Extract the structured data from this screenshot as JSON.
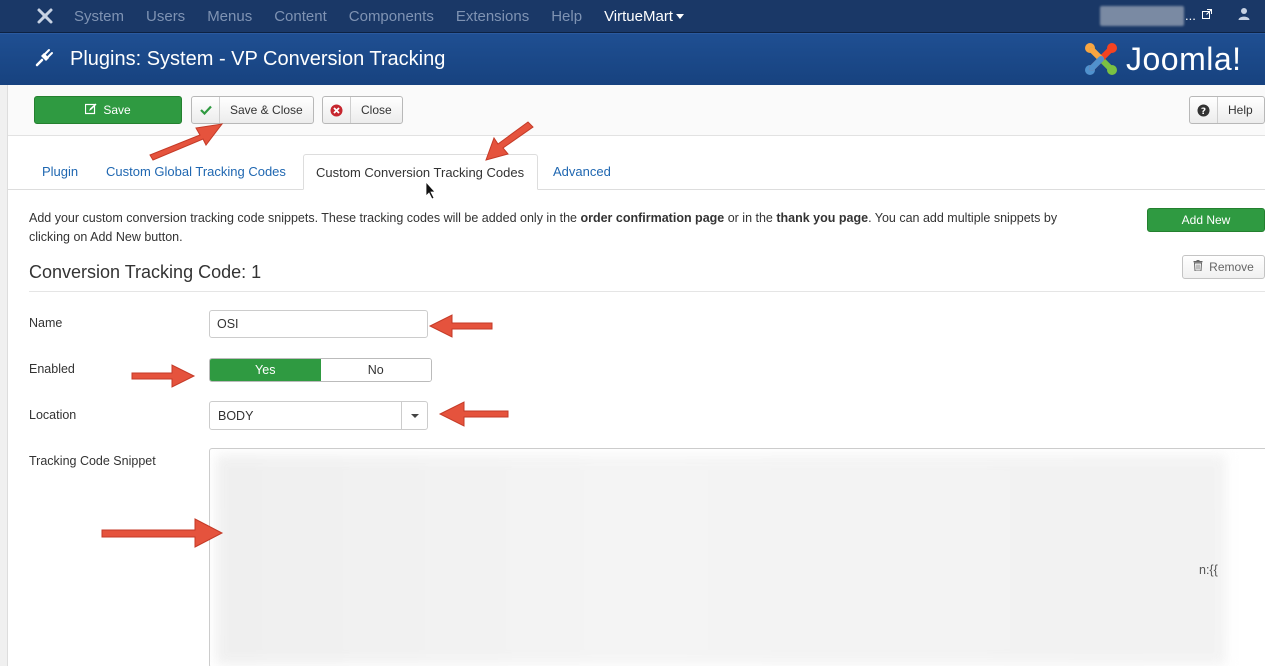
{
  "topbar": {
    "menu": [
      "System",
      "Users",
      "Menus",
      "Content",
      "Components",
      "Extensions",
      "Help"
    ],
    "active_menu": "VirtueMart",
    "ellipsis": "..."
  },
  "header": {
    "title": "Plugins: System - VP Conversion Tracking",
    "brand": "Joomla!"
  },
  "toolbar": {
    "save_label": "Save",
    "save_close_label": "Save & Close",
    "close_label": "Close",
    "help_label": "Help"
  },
  "tabs": [
    {
      "label": "Plugin"
    },
    {
      "label": "Custom Global Tracking Codes"
    },
    {
      "label": "Custom Conversion Tracking Codes"
    },
    {
      "label": "Advanced"
    }
  ],
  "description": {
    "part1": "Add your custom conversion tracking code snippets. These tracking codes will be added only in the ",
    "bold1": "order confirmation page",
    "part2": " or in the ",
    "bold2": "thank you page",
    "part3": ". You can add multiple snippets by clicking on Add New button."
  },
  "add_new_label": "Add New",
  "remove_label": "Remove",
  "section_title": "Conversion Tracking Code: 1",
  "fields": {
    "name_label": "Name",
    "name_value": "OSI",
    "enabled_label": "Enabled",
    "enabled_yes": "Yes",
    "enabled_no": "No",
    "location_label": "Location",
    "location_value": "BODY",
    "snippet_label": "Tracking Code Snippet",
    "snippet_tail": "n:{{"
  },
  "colors": {
    "topbar": "#1a3867",
    "header": "#1c4b8c",
    "success": "#2f9a41",
    "link": "#1f67b1",
    "annotation_arrow": "#e5533d"
  }
}
